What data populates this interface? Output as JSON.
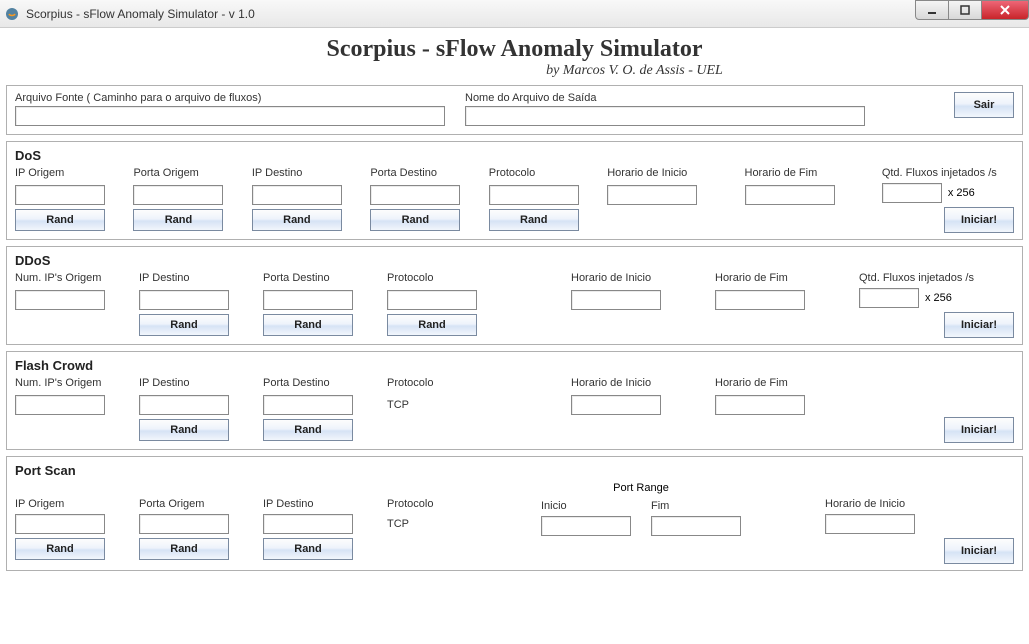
{
  "window": {
    "title": "Scorpius - sFlow Anomaly Simulator - v 1.0"
  },
  "header": {
    "title": "Scorpius - sFlow Anomaly Simulator",
    "subtitle": "by Marcos V. O. de Assis - UEL"
  },
  "files": {
    "source_label": "Arquivo Fonte ( Caminho para o arquivo de fluxos)",
    "source_value": "",
    "output_label": "Nome do Arquivo de Saída",
    "output_value": "",
    "exit_label": "Sair"
  },
  "dos": {
    "title": "DoS",
    "ip_origem": "IP Origem",
    "porta_origem": "Porta Origem",
    "ip_destino": "IP Destino",
    "porta_destino": "Porta Destino",
    "protocolo": "Protocolo",
    "horario_inicio": "Horario de Inicio",
    "horario_fim": "Horario de Fim",
    "qtd_label": "Qtd. Fluxos injetados /s",
    "x256": "x 256",
    "rand": "Rand",
    "iniciar": "Iniciar!",
    "values": {
      "ip_origem": "",
      "porta_origem": "",
      "ip_destino": "",
      "porta_destino": "",
      "protocolo": "",
      "horario_inicio": "",
      "horario_fim": "",
      "qtd": ""
    }
  },
  "ddos": {
    "title": "DDoS",
    "num_ips": "Num. IP's Origem",
    "ip_destino": "IP Destino",
    "porta_destino": "Porta Destino",
    "protocolo": "Protocolo",
    "horario_inicio": "Horario de Inicio",
    "horario_fim": "Horario de Fim",
    "qtd_label": "Qtd. Fluxos injetados /s",
    "x256": "x 256",
    "rand": "Rand",
    "iniciar": "Iniciar!",
    "values": {
      "num_ips": "",
      "ip_destino": "",
      "porta_destino": "",
      "protocolo": "",
      "horario_inicio": "",
      "horario_fim": "",
      "qtd": ""
    }
  },
  "flashcrowd": {
    "title": "Flash Crowd",
    "num_ips": "Num. IP's Origem",
    "ip_destino": "IP Destino",
    "porta_destino": "Porta Destino",
    "protocolo_label": "Protocolo",
    "protocolo_value": "TCP",
    "horario_inicio": "Horario de Inicio",
    "horario_fim": "Horario de Fim",
    "rand": "Rand",
    "iniciar": "Iniciar!",
    "values": {
      "num_ips": "",
      "ip_destino": "",
      "porta_destino": "",
      "horario_inicio": "",
      "horario_fim": ""
    }
  },
  "portscan": {
    "title": "Port Scan",
    "ip_origem": "IP Origem",
    "porta_origem": "Porta Origem",
    "ip_destino": "IP Destino",
    "protocolo_label": "Protocolo",
    "protocolo_value": "TCP",
    "port_range": "Port Range",
    "inicio": "Inicio",
    "fim": "Fim",
    "horario_inicio": "Horario de Inicio",
    "rand": "Rand",
    "iniciar": "Iniciar!",
    "values": {
      "ip_origem": "",
      "porta_origem": "",
      "ip_destino": "",
      "inicio": "",
      "fim": "",
      "horario_inicio": ""
    }
  }
}
